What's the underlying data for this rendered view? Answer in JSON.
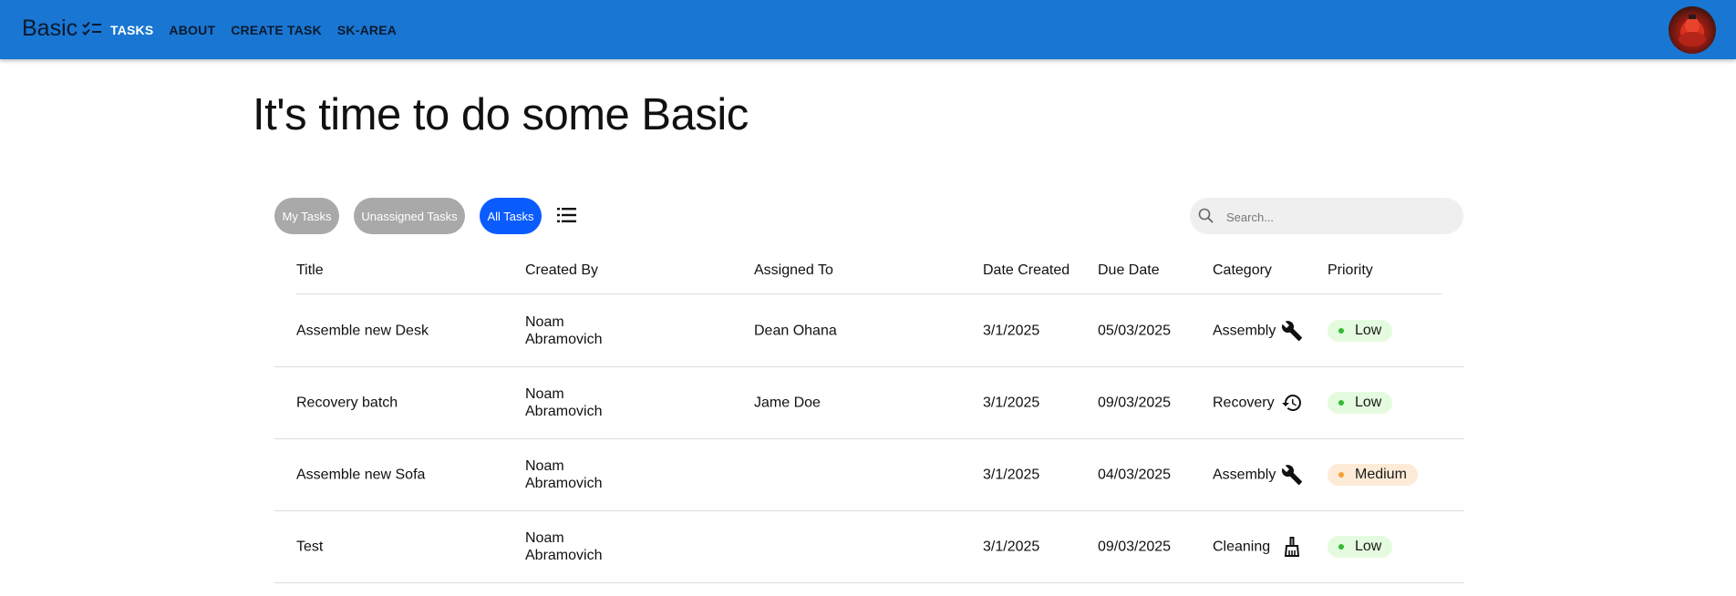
{
  "appbar": {
    "brand": "Basic",
    "brand_icon": "checklist-icon",
    "color": "#1976d2",
    "nav": [
      {
        "label": "TASKS",
        "active": true
      },
      {
        "label": "ABOUT",
        "active": false
      },
      {
        "label": "CREATE TASK",
        "active": false
      },
      {
        "label": "SK-AREA",
        "active": false
      }
    ]
  },
  "headline": "It's time to do some Basic",
  "filters": {
    "buttons": [
      {
        "label": "My Tasks",
        "active": false
      },
      {
        "label": "Unassigned Tasks",
        "active": false
      },
      {
        "label": "All Tasks",
        "active": true
      }
    ],
    "view_icon": "list-icon",
    "search_placeholder": "Search..."
  },
  "table": {
    "columns": [
      "Title",
      "Created By",
      "Assigned To",
      "Date Created",
      "Due Date",
      "Category",
      "Priority"
    ],
    "rows": [
      {
        "title": "Assemble new Desk",
        "created_by": [
          "Noam",
          "Abramovich"
        ],
        "assigned_to": "Dean Ohana",
        "date_created": "3/1/2025",
        "due_date": "05/03/2025",
        "category": "Assembly",
        "category_icon": "wrench-icon",
        "priority": "Low"
      },
      {
        "title": "Recovery batch",
        "created_by": [
          "Noam",
          "Abramovich"
        ],
        "assigned_to": "Jame Doe",
        "date_created": "3/1/2025",
        "due_date": "09/03/2025",
        "category": "Recovery",
        "category_icon": "restore-icon",
        "priority": "Low"
      },
      {
        "title": "Assemble new Sofa",
        "created_by": [
          "Noam",
          "Abramovich"
        ],
        "assigned_to": "",
        "date_created": "3/1/2025",
        "due_date": "04/03/2025",
        "category": "Assembly",
        "category_icon": "wrench-icon",
        "priority": "Medium"
      },
      {
        "title": "Test",
        "created_by": [
          "Noam",
          "Abramovich"
        ],
        "assigned_to": "",
        "date_created": "3/1/2025",
        "due_date": "09/03/2025",
        "category": "Cleaning",
        "category_icon": "broom-icon",
        "priority": "Low"
      }
    ]
  }
}
